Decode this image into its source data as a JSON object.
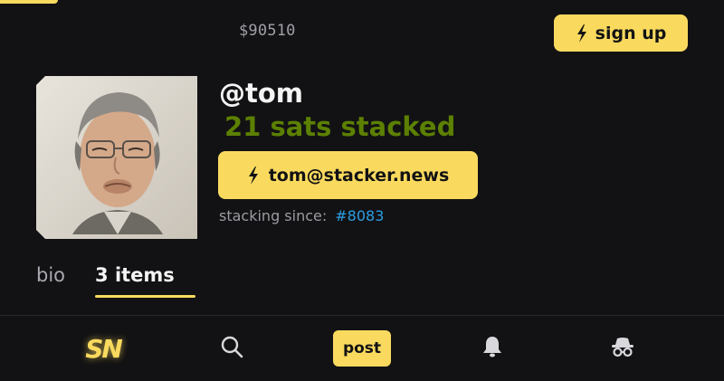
{
  "header": {
    "price": "$90510",
    "signup_label": "sign up"
  },
  "profile": {
    "handle": "@tom",
    "stacked": "21 sats stacked",
    "email": "tom@stacker.news",
    "since_label": "stacking since:",
    "since_item": "#8083"
  },
  "tabs": [
    {
      "label": "bio",
      "active": false
    },
    {
      "label": "3 items",
      "active": true
    }
  ],
  "bottom_nav": {
    "logo": "SN",
    "post_label": "post",
    "icons": [
      "search-icon",
      "bell-icon",
      "incognito-icon"
    ]
  },
  "colors": {
    "accent": "#fada5e",
    "background": "#121214",
    "stacked_green": "#5c8001",
    "link_blue": "#2c9de0"
  }
}
